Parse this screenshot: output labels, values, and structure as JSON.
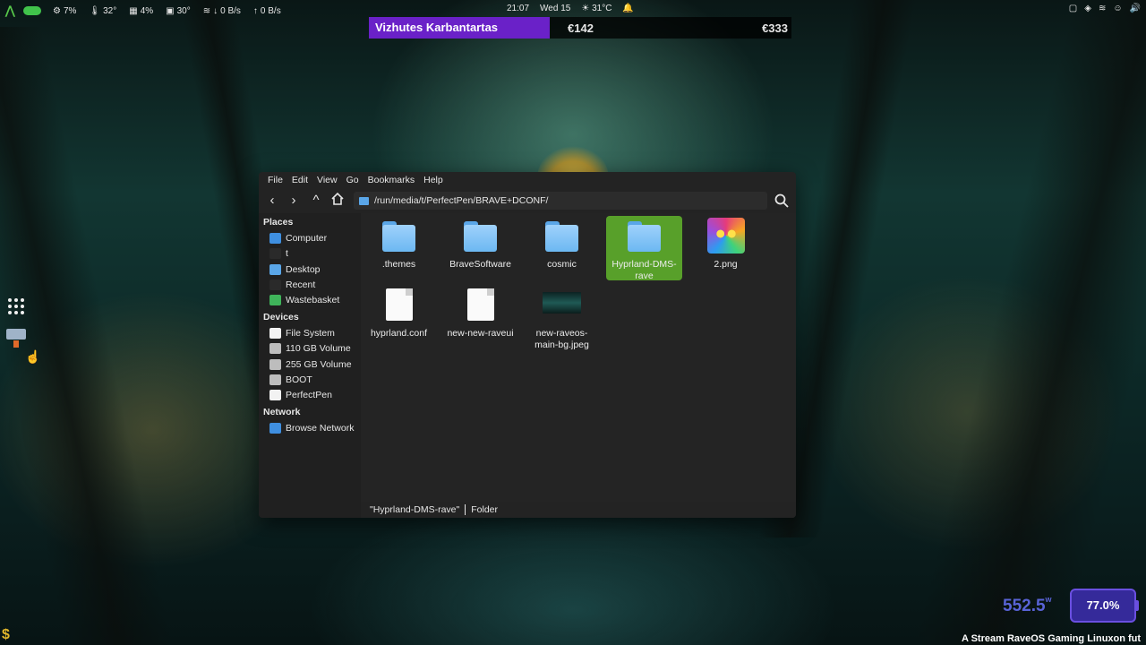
{
  "topbar": {
    "cpu": "7%",
    "cpu_temp": "32°",
    "memory": "4%",
    "gpu_temp": "30°",
    "net_down": "0 B/s",
    "net_up": "0 B/s",
    "time": "21:07",
    "date": "Wed 15",
    "weather": "31°C"
  },
  "ticker": {
    "name": "Vizhutes Karbantartas",
    "price1": "€142",
    "price2": "€333"
  },
  "file_manager": {
    "menu": [
      "File",
      "Edit",
      "View",
      "Go",
      "Bookmarks",
      "Help"
    ],
    "path": "/run/media/t/PerfectPen/BRAVE+DCONF/",
    "sidebar": {
      "places_title": "Places",
      "places": [
        "Computer",
        "t",
        "Desktop",
        "Recent",
        "Wastebasket"
      ],
      "devices_title": "Devices",
      "devices": [
        "File System",
        "110 GB Volume",
        "255 GB Volume",
        "BOOT",
        "PerfectPen"
      ],
      "network_title": "Network",
      "network": [
        "Browse Network"
      ]
    },
    "items": [
      {
        "label": ".themes",
        "type": "folder"
      },
      {
        "label": "BraveSoftware",
        "type": "folder"
      },
      {
        "label": "cosmic",
        "type": "folder"
      },
      {
        "label": "Hyprland-DMS-\nrave",
        "type": "folder",
        "selected": true
      },
      {
        "label": "2.png",
        "type": "image"
      },
      {
        "label": "hyprland.conf",
        "type": "file"
      },
      {
        "label": "new-new-raveui",
        "type": "file"
      },
      {
        "label": "new-raveos-\nmain-bg.jpeg",
        "type": "image"
      }
    ],
    "status": {
      "selection": "\"Hyprland-DMS-rave\"",
      "kind": "Folder"
    }
  },
  "widgets": {
    "power": "552.5",
    "power_unit": "w",
    "percent": "77.0%",
    "marquee": "A Stream RaveOS Gaming Linuxon fut"
  },
  "colors": {
    "accent_green": "#58a02a",
    "ticker_purple": "#6a21c8",
    "folder_blue": "#6cb8f2"
  }
}
